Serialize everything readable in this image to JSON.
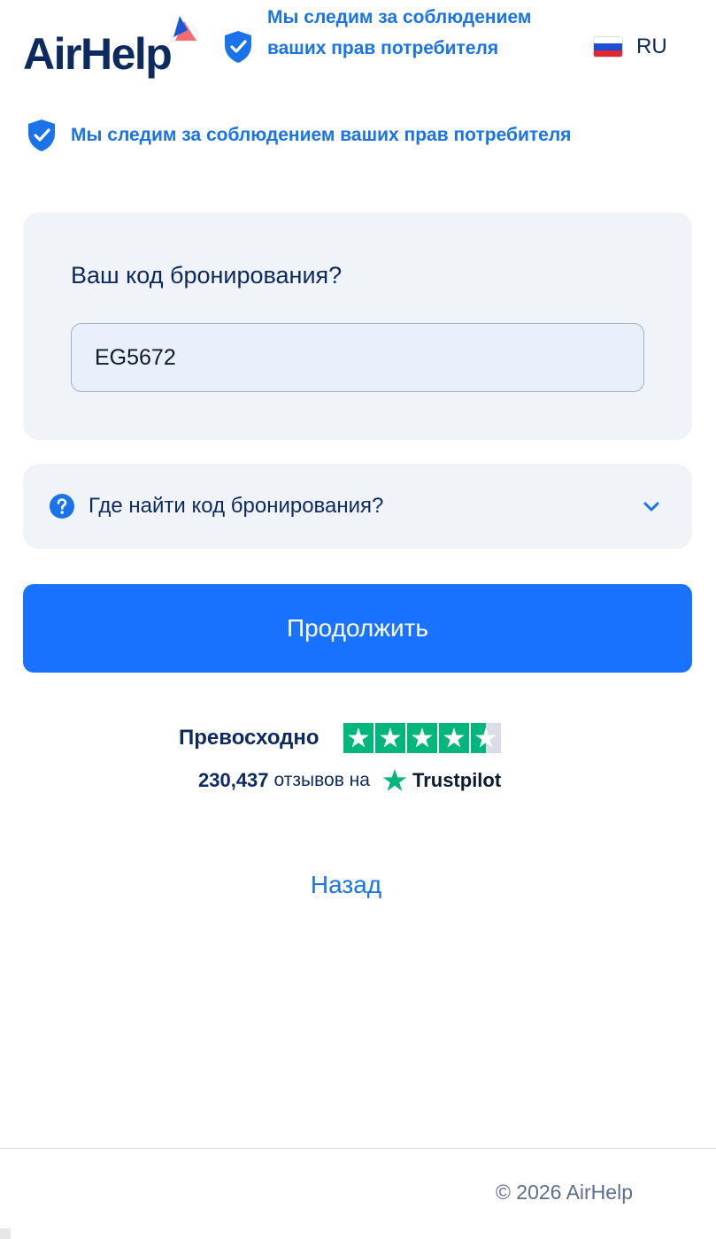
{
  "header": {
    "brand": "AirHelp",
    "tagline": "Мы следим за соблюдением ваших прав потребителя",
    "language": {
      "code": "RU",
      "flag": "russia-flag-icon"
    }
  },
  "notice": {
    "text": "Мы следим за соблюдением ваших прав потребителя",
    "icon": "shield-check-icon"
  },
  "booking_form": {
    "label": "Ваш код бронирования?",
    "input_value": "EG5672"
  },
  "help": {
    "text": "Где найти код бронирования?",
    "icon": "question-icon",
    "expand_icon": "chevron-down-icon"
  },
  "actions": {
    "continue_label": "Продолжить",
    "back_label": "Назад"
  },
  "trustpilot": {
    "rating_label": "Превосходно",
    "stars_filled": 4.5,
    "stars_total": 5,
    "review_count": "230,437",
    "reviews_text": "отзывов на",
    "brand": "Trustpilot"
  },
  "footer": {
    "copyright": "© 2026 AirHelp"
  },
  "colors": {
    "navy": "#0d2a5e",
    "blue_accent": "#1a73e8",
    "button_blue": "#1a73ff",
    "panel_bg": "#f0f3f8",
    "trustpilot_green": "#00b67a",
    "logo_red": "#f2545b"
  }
}
